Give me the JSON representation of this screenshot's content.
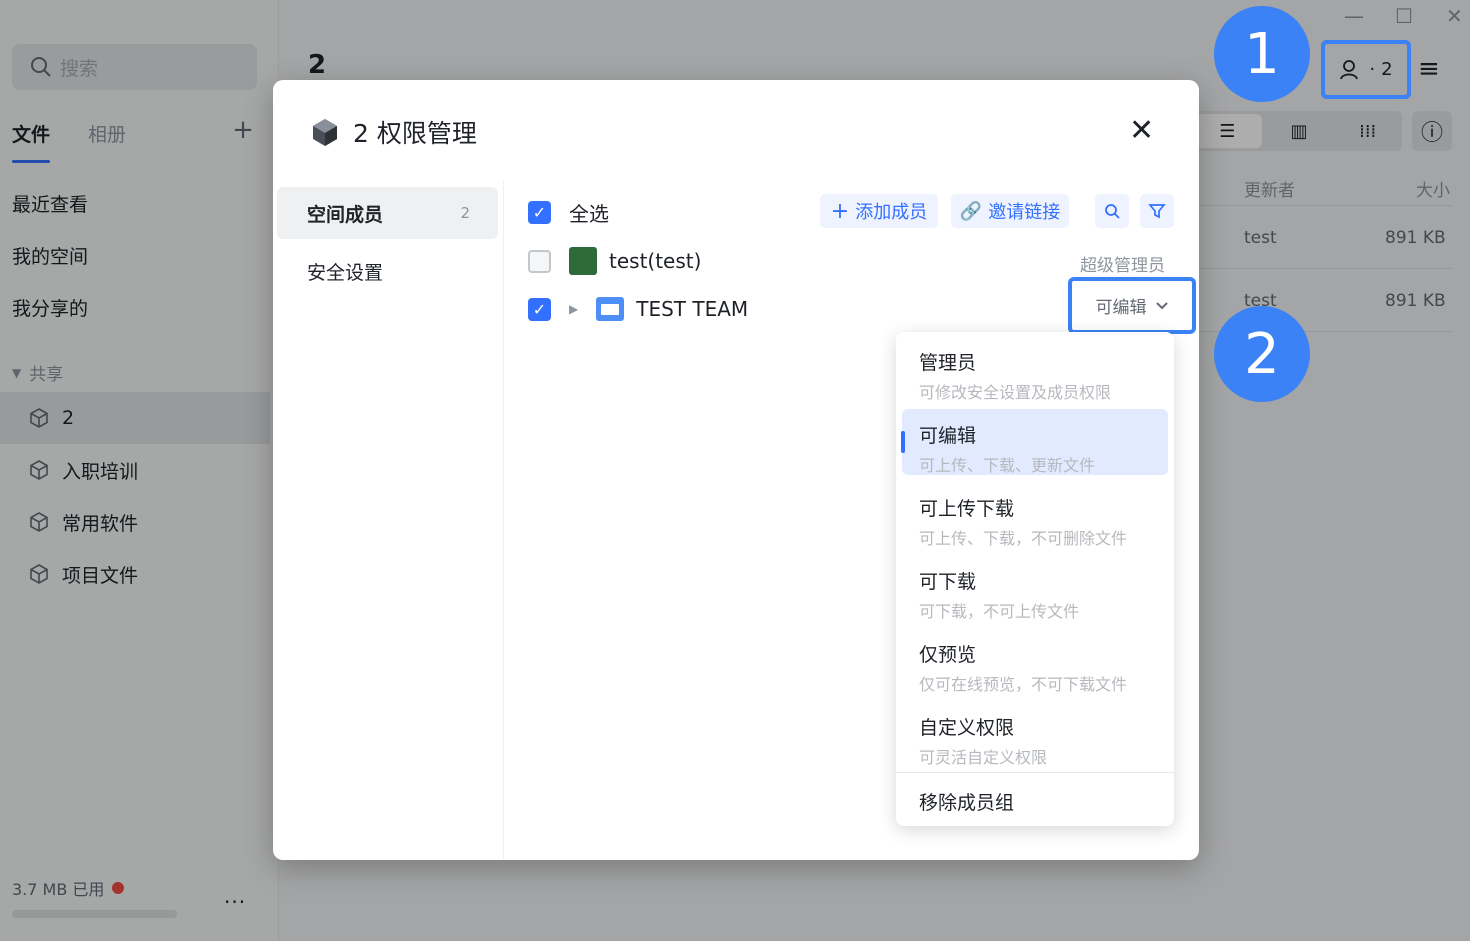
{
  "sidebar": {
    "search_placeholder": "搜索",
    "tabs": [
      "文件",
      "相册"
    ],
    "add_label": "+",
    "nav": [
      "最近查看",
      "我的空间",
      "我分享的"
    ],
    "shared_header": "共享",
    "spaces": [
      "2",
      "入职培训",
      "常用软件",
      "项目文件"
    ],
    "storage": "3.7 MB 已用",
    "more": "···"
  },
  "main": {
    "title": "2",
    "members_count": "2",
    "columns": {
      "updater": "更新者",
      "size": "大小"
    },
    "rows": [
      {
        "updater": "test",
        "size": "891 KB"
      },
      {
        "updater": "test",
        "size": "891 KB"
      }
    ]
  },
  "badges": [
    "1",
    "2"
  ],
  "dialog": {
    "title": "2 权限管理",
    "nav": [
      {
        "label": "空间成员",
        "count": "2"
      },
      {
        "label": "安全设置"
      }
    ],
    "select_all": "全选",
    "add_member": "添加成员",
    "invite_link": "邀请链接",
    "members": [
      {
        "name": "test(test)",
        "role": "超级管理员"
      },
      {
        "name": "TEST TEAM",
        "role": "可编辑"
      }
    ]
  },
  "dropdown": {
    "options": [
      {
        "title": "管理员",
        "desc": "可修改安全设置及成员权限"
      },
      {
        "title": "可编辑",
        "desc": "可上传、下载、更新文件"
      },
      {
        "title": "可上传下载",
        "desc": "可上传、下载，不可删除文件"
      },
      {
        "title": "可下载",
        "desc": "可下载，不可上传文件"
      },
      {
        "title": "仅预览",
        "desc": "仅可在线预览，不可下载文件"
      },
      {
        "title": "自定义权限",
        "desc": "可灵活自定义权限"
      }
    ],
    "selected_index": 1,
    "remove": "移除成员组"
  },
  "colors": {
    "accent": "#3370ff",
    "highlight_border": "#3b82f6",
    "badge": "#3b82f6"
  }
}
